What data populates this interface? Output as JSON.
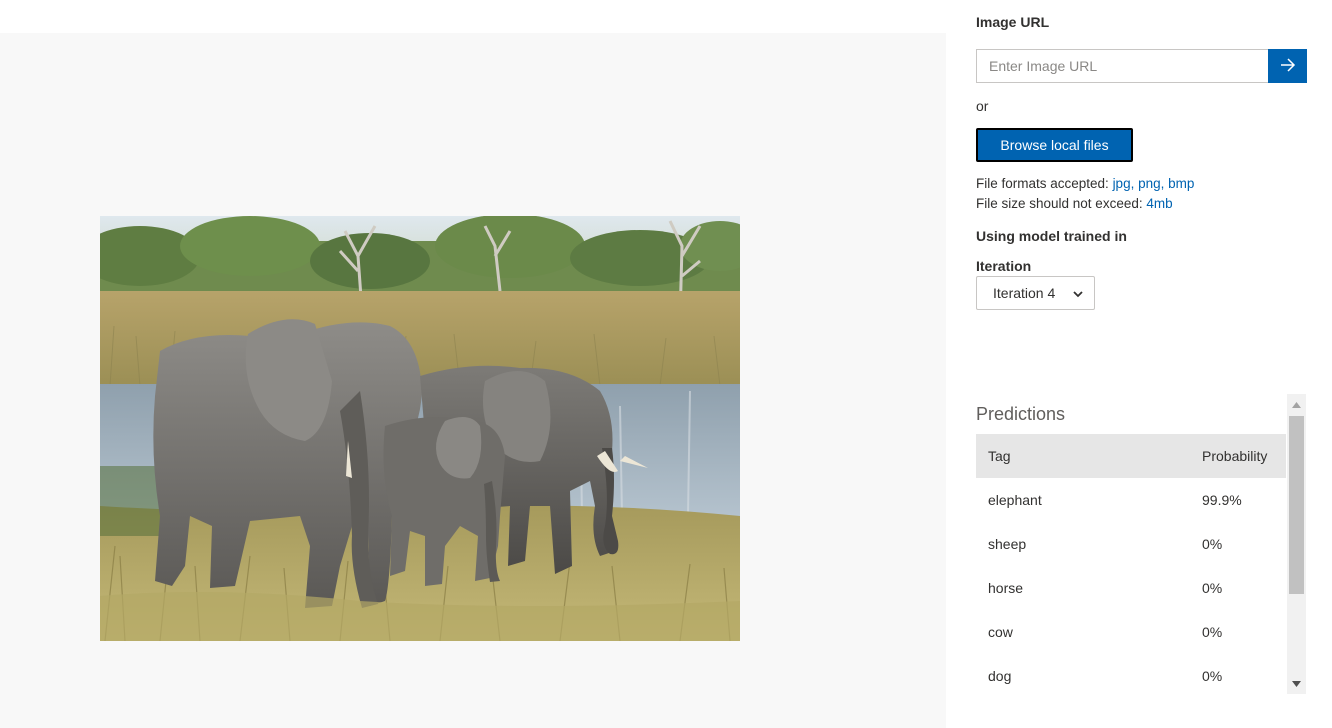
{
  "image_input": {
    "label": "Image URL",
    "placeholder": "Enter Image URL",
    "value": "",
    "submit_icon": "arrow-right-icon"
  },
  "or_text": "or",
  "browse": {
    "label": "Browse local files"
  },
  "file_info": {
    "formats_prefix": "File formats accepted: ",
    "formats_value": "jpg, png, bmp",
    "size_prefix": "File size should not exceed: ",
    "size_value": "4mb"
  },
  "model": {
    "label": "Using model trained in",
    "iteration_label": "Iteration",
    "iteration_selected": "Iteration 4"
  },
  "predictions": {
    "title": "Predictions",
    "columns": {
      "tag": "Tag",
      "probability": "Probability"
    },
    "rows": [
      {
        "tag": "elephant",
        "probability": "99.9%"
      },
      {
        "tag": "sheep",
        "probability": "0%"
      },
      {
        "tag": "horse",
        "probability": "0%"
      },
      {
        "tag": "cow",
        "probability": "0%"
      },
      {
        "tag": "dog",
        "probability": "0%"
      }
    ]
  },
  "colors": {
    "accent": "#0063b1",
    "stage_bg": "#f8f8f8",
    "table_header_bg": "#e6e6e6"
  }
}
